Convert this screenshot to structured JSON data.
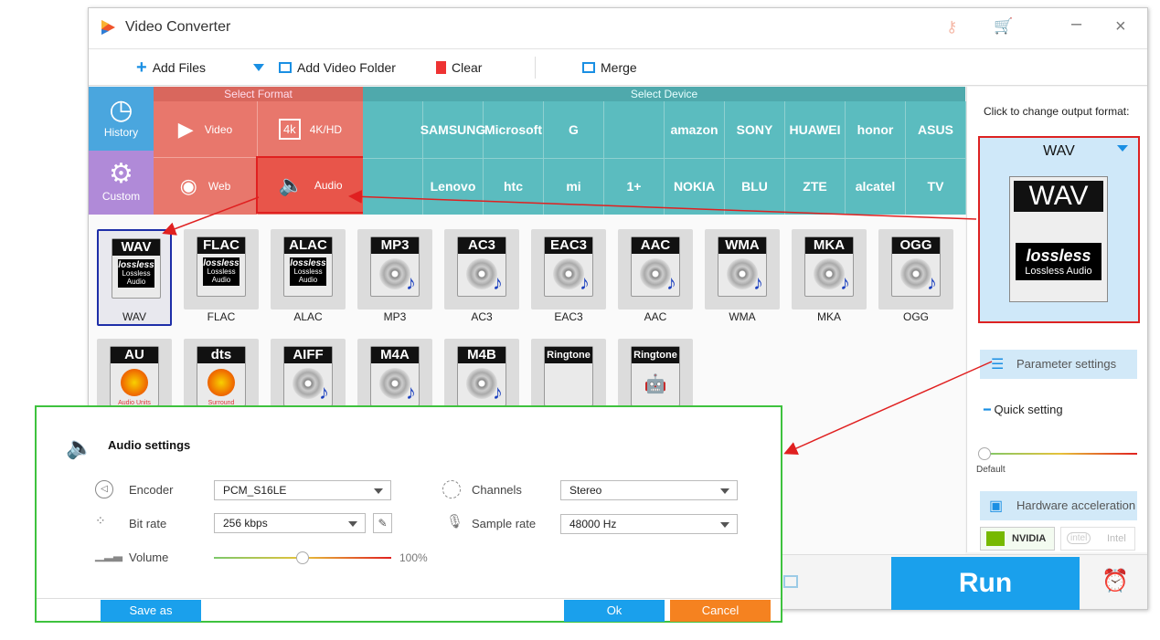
{
  "app": {
    "title": "Video Converter"
  },
  "toolbar": {
    "add_files": "Add Files",
    "add_folder": "Add Video Folder",
    "clear": "Clear",
    "merge": "Merge"
  },
  "sidebar": {
    "history": "History",
    "custom": "Custom"
  },
  "sections": {
    "select_format": "Select Format",
    "select_device": "Select Device"
  },
  "format_tabs": [
    {
      "label": "Video"
    },
    {
      "label": "4K/HD"
    },
    {
      "label": "Web"
    },
    {
      "label": "Audio"
    }
  ],
  "devices_row1": [
    "",
    "SAMSUNG",
    "Microsoft",
    "G",
    "",
    "amazon",
    "SONY",
    "HUAWEI",
    "honor",
    "ASUS"
  ],
  "devices_row2": [
    "",
    "Lenovo",
    "htc",
    "mi",
    "1+",
    "NOKIA",
    "BLU",
    "ZTE",
    "alcatel",
    "TV"
  ],
  "formats_row1": [
    {
      "head": "WAV",
      "caption": "WAV",
      "lossless": true
    },
    {
      "head": "FLAC",
      "caption": "FLAC",
      "lossless": true
    },
    {
      "head": "ALAC",
      "caption": "ALAC",
      "lossless": true
    },
    {
      "head": "MP3",
      "caption": "MP3"
    },
    {
      "head": "AC3",
      "caption": "AC3"
    },
    {
      "head": "EAC3",
      "caption": "EAC3"
    },
    {
      "head": "AAC",
      "caption": "AAC"
    },
    {
      "head": "WMA",
      "caption": "WMA"
    },
    {
      "head": "MKA",
      "caption": "MKA"
    },
    {
      "head": "OGG",
      "caption": "OGG"
    }
  ],
  "formats_row2": [
    {
      "head": "AU",
      "sub": "Audio Units"
    },
    {
      "head": "dts",
      "sub": "Surround"
    },
    {
      "head": "AIFF"
    },
    {
      "head": "M4A"
    },
    {
      "head": "M4B"
    },
    {
      "head": "Ringtone"
    },
    {
      "head": "Ringtone"
    }
  ],
  "lossless_text": {
    "badge": "lossless",
    "sub": "Lossless Audio",
    "sub_small": "Lossless\nAudio"
  },
  "right_panel": {
    "hint": "Click to change output format:",
    "format": "WAV",
    "badge": "WAV",
    "lossless": "lossless",
    "lossless_sub": "Lossless Audio",
    "param": "Parameter settings",
    "quick": "Quick setting",
    "default": "Default",
    "hw": "Hardware acceleration",
    "nvidia": "NVIDIA",
    "intel": "Intel"
  },
  "run": {
    "label": "Run"
  },
  "dialog": {
    "title": "Audio settings",
    "encoder_label": "Encoder",
    "encoder": "PCM_S16LE",
    "bitrate_label": "Bit rate",
    "bitrate": "256 kbps",
    "volume_label": "Volume",
    "volume_value": "100%",
    "volume_fraction": 0.5,
    "channels_label": "Channels",
    "channels": "Stereo",
    "samplerate_label": "Sample rate",
    "samplerate": "48000 Hz",
    "save_as": "Save as",
    "ok": "Ok",
    "cancel": "Cancel"
  },
  "colors": {
    "accent_blue": "#1aa0ec",
    "format_red": "#e8776c",
    "device_teal": "#5bbcbf",
    "nav_blue": "#4aa6de",
    "custom_purple": "#b08ad8",
    "dialog_border": "#3ec23e",
    "annotation_red": "#e02020",
    "cancel_orange": "#f58220"
  }
}
